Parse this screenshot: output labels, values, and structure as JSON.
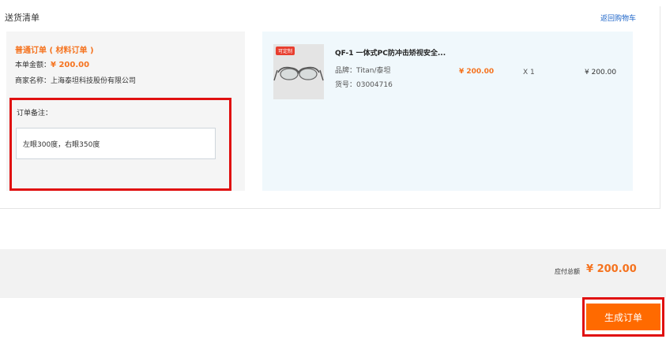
{
  "header": {
    "title": "送货清单",
    "back_to_cart": "返回购物车"
  },
  "order": {
    "type_label": "普通订单 ( 材料订单 )",
    "amount_label": "本单金额：",
    "amount_value": "¥ 200.00",
    "merchant_label": "商家名称：",
    "merchant_value": "上海泰坦科技股份有限公司",
    "note_label": "订单备注：",
    "note_value": "左眼300度，右眼350度"
  },
  "product": {
    "tag": "可定制",
    "name": "QF-1 一体式PC防冲击矫视安全...",
    "brand": "品牌：Titan/泰坦",
    "sku": "货号：03004716",
    "price": "¥ 200.00",
    "quantity": "X 1",
    "subtotal": "¥ 200.00"
  },
  "summary": {
    "total_label": "应付总额",
    "total_value": "¥ 200.00"
  },
  "actions": {
    "submit_label": "生成订单"
  },
  "colors": {
    "accent": "#f5731f",
    "submit": "#ff6a00",
    "highlight": "#e01010",
    "link": "#1c64c8"
  }
}
